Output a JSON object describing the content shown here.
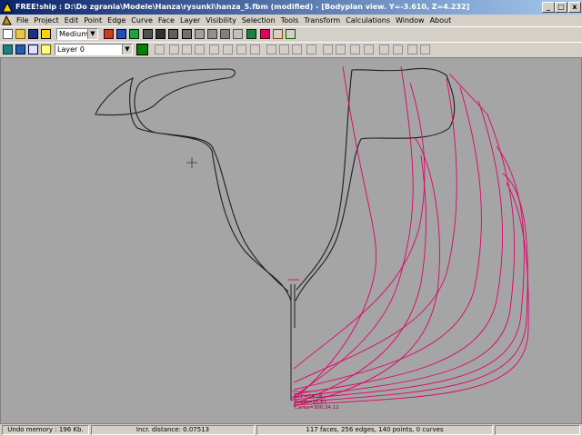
{
  "window": {
    "title": "FREE!ship  :  D:\\Do zgrania\\Modele\\Hanza\\rysunki\\hanza_5.fbm (modified) - [Bodyplan view.  Y=-3.610,  Z=4.232]",
    "minimize_label": "_",
    "maximize_label": "□",
    "close_label": "x"
  },
  "menu": [
    "File",
    "Project",
    "Edit",
    "Point",
    "Edge",
    "Curve",
    "Face",
    "Layer",
    "Visibility",
    "Selection",
    "Tools",
    "Transform",
    "Calculations",
    "Window",
    "About"
  ],
  "toolbar1": {
    "precision_value": "Medium"
  },
  "toolbar2": {
    "layer_value": "Layer 0",
    "layer_color": "#008000"
  },
  "viewport": {
    "background": "#a5a5a5",
    "annotations": [
      "LCF=24.28",
      "Fsum=11.67",
      "Carea=300.34.11"
    ]
  },
  "status": {
    "undo": "Undo memory : 196 Kb.",
    "incr": "Incr. distance: 0.07513",
    "geom": "117 faces, 256 edges, 140 points, 0 curves"
  },
  "colors": {
    "hull_line": "#1e1e1e",
    "station_line": "#e0006a",
    "title_from": "#0a246a",
    "title_to": "#a6caf0"
  }
}
